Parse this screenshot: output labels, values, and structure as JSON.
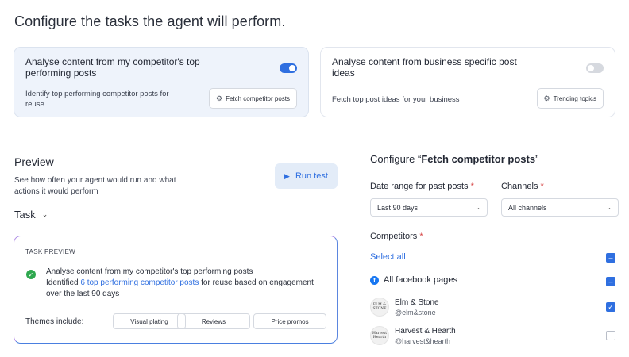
{
  "page_title": "Configure the tasks the agent will perform.",
  "cards": [
    {
      "title": "Analyse content from my competitor's top performing posts",
      "description": "Identify top performing competitor posts for reuse",
      "button": "Fetch competitor posts",
      "button_icon": "gear-icon",
      "enabled": true
    },
    {
      "title": "Analyse content from business specific post ideas",
      "description": "Fetch top post ideas for your business",
      "button": "Trending topics",
      "button_icon": "gear-icon",
      "enabled": false
    }
  ],
  "preview": {
    "title": "Preview",
    "description": "See how often your agent would run and what actions it would perform",
    "run_button": "Run test",
    "task_label": "Task",
    "task_preview_label": "TASK PREVIEW",
    "task_line1": "Analyse content from my competitor's top performing posts",
    "task_line2_prefix": "Identified ",
    "task_line2_link": "6 top performing competitor posts",
    "task_line2_suffix": " for reuse based on engagement over the last 90 days",
    "themes_label": "Themes include:",
    "themes": [
      "Visual plating",
      "Reviews",
      "Price promos"
    ]
  },
  "config": {
    "title_prefix": "Configure “",
    "title_bold": "Fetch competitor posts",
    "title_suffix": "”",
    "date_range_label": "Date range for past posts",
    "date_range_value": "Last 90 days",
    "channels_label": "Channels",
    "channels_value": "All channels",
    "required_mark": "*",
    "competitors_label": "Competitors",
    "select_all": "Select all",
    "all_facebook_pages": "All facebook pages",
    "competitors": [
      {
        "name": "Elm & Stone",
        "handle": "@elm&stone",
        "avatar_text": "ELM & STONE",
        "checked": true
      },
      {
        "name": "Harvest & Hearth",
        "handle": "@harvest&hearth",
        "avatar_text": "Harvest Hearth",
        "checked": false
      }
    ]
  },
  "colors": {
    "accent": "#2f6fe0",
    "success": "#2fa84f",
    "required": "#d64545",
    "facebook": "#1877f2"
  }
}
